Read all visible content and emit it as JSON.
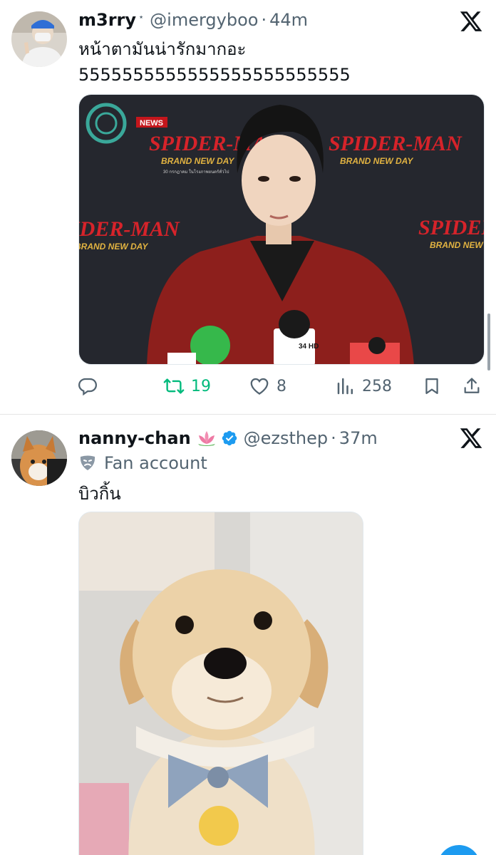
{
  "tweets": [
    {
      "display_name": "m3rry",
      "name_symbol": "⋆",
      "handle": "@imergyboo",
      "separator": "·",
      "time": "44m",
      "text_lines": [
        "หน้าตามันน่ารักมากอะ",
        "5555555555555555555555555"
      ],
      "media": {
        "logo_badge": "NEWS",
        "backdrop_lines": [
          "SPIDER-MAN",
          "BRAND NEW DAY",
          "30 กรกฎาคม ในโรงภาพยนตร์ทั่วไป"
        ],
        "mic_label": "34 HD"
      },
      "actions": {
        "reply_count": "",
        "retweet_count": "19",
        "like_count": "8",
        "views_count": "258"
      }
    },
    {
      "display_name": "nanny-chan",
      "handle": "@ezsthep",
      "separator": "·",
      "time": "37m",
      "label": "Fan account",
      "text": "บิวกิ้น"
    }
  ],
  "colors": {
    "accent": "#1d9bf0",
    "secondary_text": "#536471",
    "retweet_green": "#00ba7c"
  },
  "icons": [
    "x-logo-icon",
    "verified-badge-icon",
    "lotus-emoji-icon",
    "theater-mask-icon",
    "reply-icon",
    "retweet-icon",
    "like-icon",
    "views-icon",
    "bookmark-icon",
    "share-icon"
  ]
}
